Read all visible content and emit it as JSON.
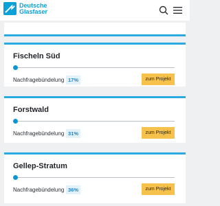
{
  "header": {
    "brand_line1": "Deutsche",
    "brand_line2": "Glasfaser",
    "brand_color": "#0aa1d9",
    "search_icon": "search-icon",
    "menu_icon": "hamburger-menu-icon"
  },
  "colors": {
    "accent": "#29aae1",
    "button": "#f6c24c",
    "badge_bg": "#e3f1f9",
    "badge_text": "#1b86c9"
  },
  "projects": [
    {
      "name": "Fischeln Süd",
      "label": "Nachfragebündelung",
      "percent": "17%",
      "progress": 0,
      "button_label": "zum Projekt"
    },
    {
      "name": "Forstwald",
      "label": "Nachfragebündelung",
      "percent": "31%",
      "progress": 0,
      "button_label": "zum Projekt"
    },
    {
      "name": "Gellep-Stratum",
      "label": "Nachfragebündelung",
      "percent": "36%",
      "progress": 0,
      "button_label": "zum Projekt"
    }
  ]
}
